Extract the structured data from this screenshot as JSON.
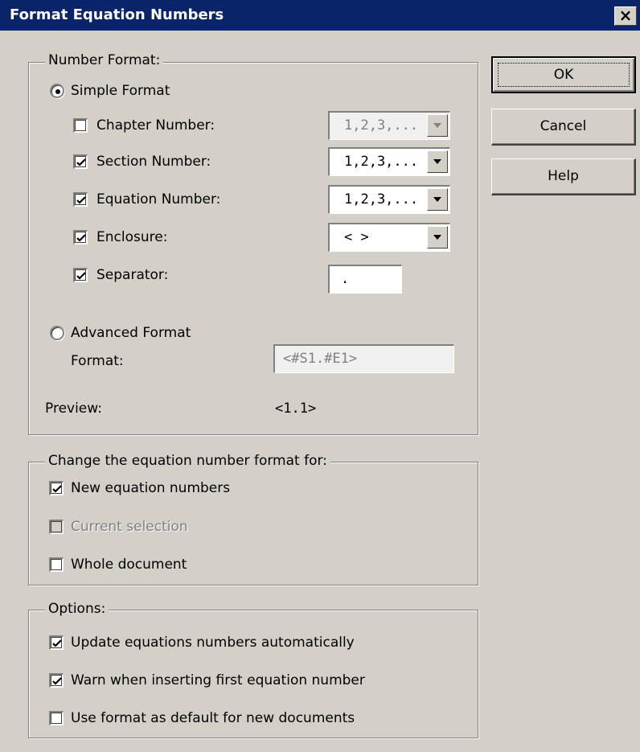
{
  "window": {
    "title": "Format Equation Numbers",
    "close_glyph": "×"
  },
  "buttons": {
    "ok": "OK",
    "cancel": "Cancel",
    "help": "Help"
  },
  "number_format": {
    "legend": "Number Format:",
    "simple_format": {
      "label": "Simple Format",
      "selected": true
    },
    "chapter": {
      "label": "Chapter Number:",
      "checked": false,
      "value": "1,2,3,...",
      "enabled": false
    },
    "section": {
      "label": "Section Number:",
      "checked": true,
      "value": "1,2,3,..."
    },
    "equation": {
      "label": "Equation Number:",
      "checked": true,
      "value": "1,2,3,..."
    },
    "enclosure": {
      "label": "Enclosure:",
      "checked": true,
      "value": "< >"
    },
    "separator": {
      "label": "Separator:",
      "checked": true,
      "value": "."
    },
    "advanced_format": {
      "label": "Advanced Format",
      "selected": false
    },
    "format": {
      "label": "Format:",
      "value": "<#S1.#E1>",
      "enabled": false
    },
    "preview": {
      "label": "Preview:",
      "value": "<1.1>"
    }
  },
  "change_for": {
    "legend": "Change the equation number format for:",
    "new_numbers": {
      "label": "New equation numbers",
      "checked": true
    },
    "current_selection": {
      "label": "Current selection",
      "checked": false,
      "enabled": false
    },
    "whole_document": {
      "label": "Whole document",
      "checked": false
    }
  },
  "options": {
    "legend": "Options:",
    "update_auto": {
      "label": "Update equations numbers automatically",
      "checked": true
    },
    "warn_first": {
      "label": "Warn when inserting first equation number",
      "checked": true
    },
    "use_default": {
      "label": "Use format as default for new documents",
      "checked": false
    }
  },
  "colors": {
    "titlebar": "#0a246a",
    "dialog_face": "#d4d0c8",
    "disabled_text": "#808080"
  }
}
